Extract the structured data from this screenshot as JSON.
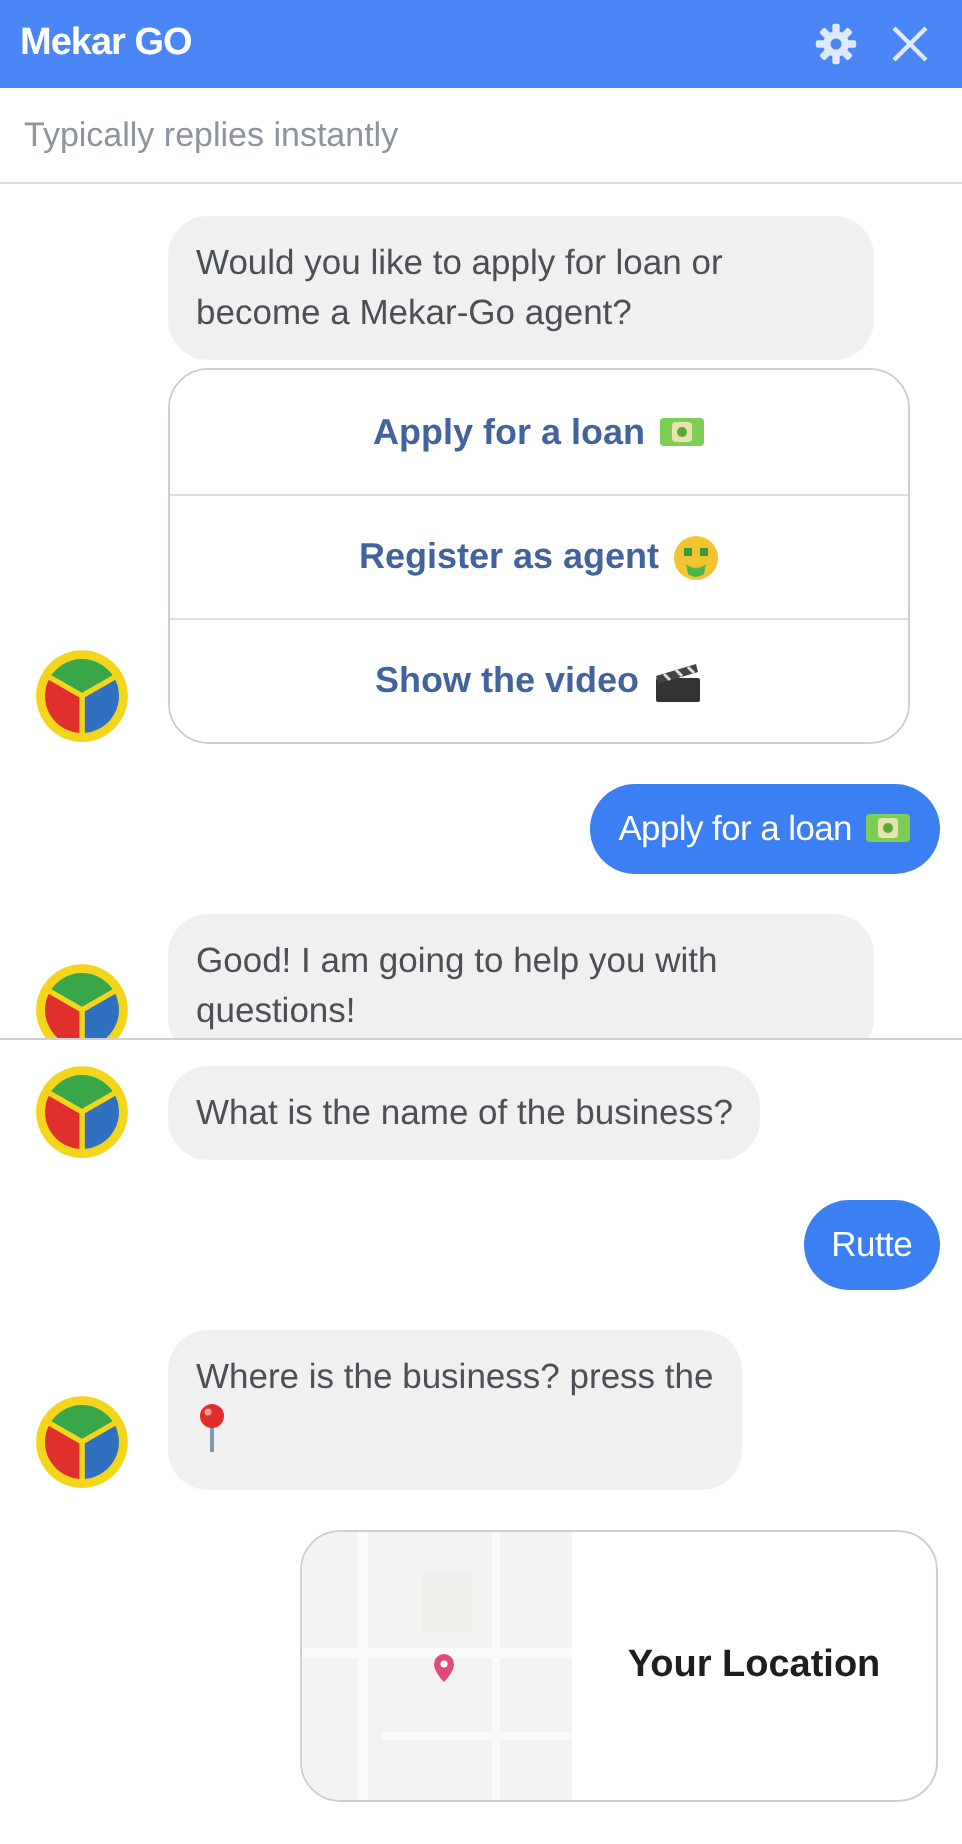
{
  "header": {
    "title": "Mekar GO"
  },
  "subtitle": "Typically replies instantly",
  "sections": [
    {
      "clipped": true,
      "messages": [
        {
          "kind": "bot",
          "avatar": false,
          "text": "Would you like to apply for loan or become a Mekar-Go agent?"
        },
        {
          "kind": "quick_replies",
          "avatar": true,
          "options": [
            {
              "label": "Apply for a loan",
              "kind": "money"
            },
            {
              "label": "Register as agent",
              "kind": "moneyface"
            },
            {
              "label": "Show the video",
              "kind": "clapper"
            }
          ]
        },
        {
          "kind": "user",
          "text": "Apply for a loan",
          "icon": {
            "kind": "money"
          }
        },
        {
          "kind": "bot",
          "avatar": true,
          "text": "Good! I am going to help you with questions!"
        }
      ]
    },
    {
      "clipped": false,
      "messages": [
        {
          "kind": "bot",
          "avatar": true,
          "text": "What is the name of the business?"
        },
        {
          "kind": "user",
          "text": "Rutte"
        },
        {
          "kind": "bot",
          "avatar": true,
          "text": "Where is the business? press the",
          "icon": {
            "kind": "pin"
          }
        },
        {
          "kind": "location",
          "label": "Your Location"
        }
      ]
    }
  ]
}
